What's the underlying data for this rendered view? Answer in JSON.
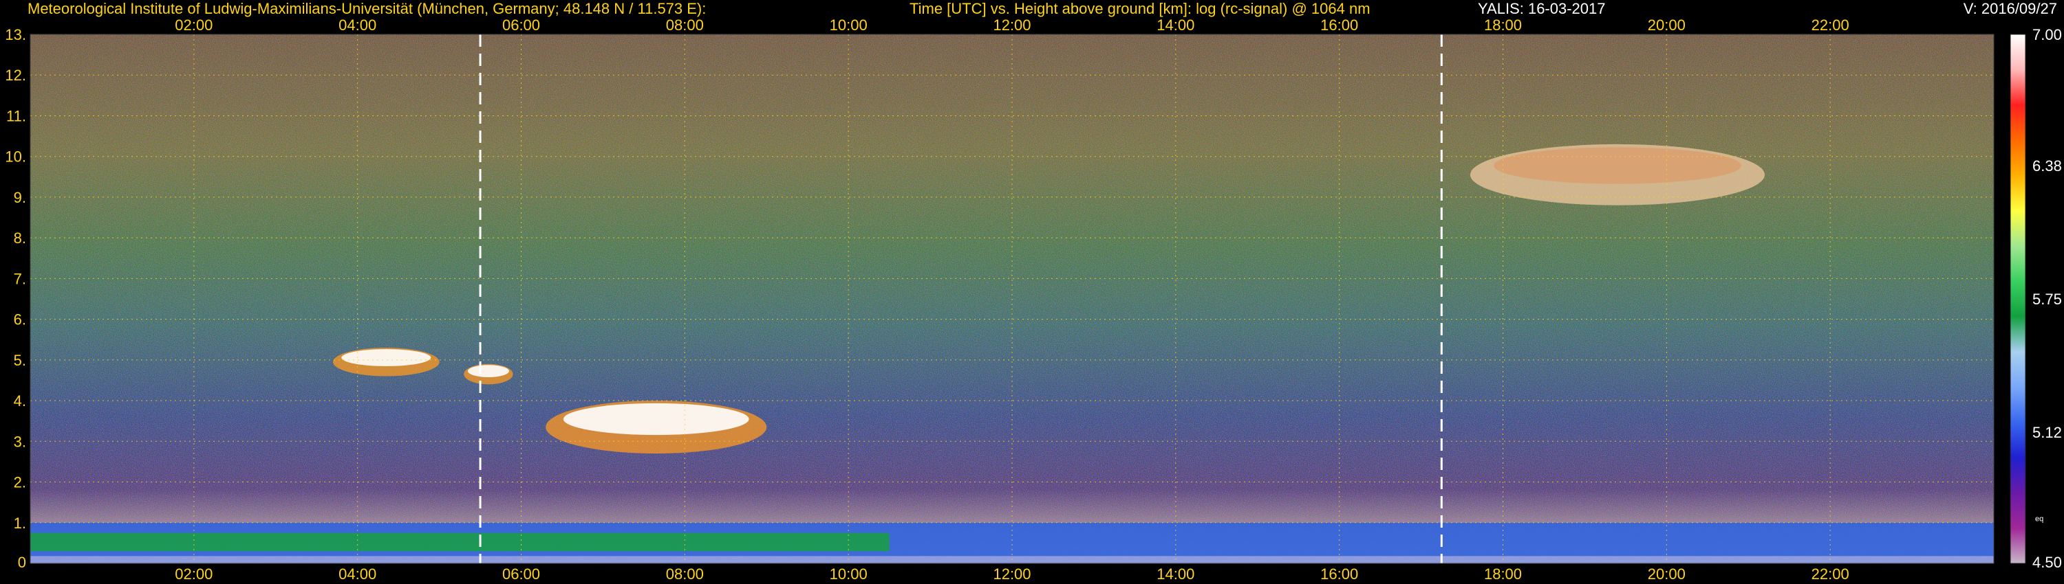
{
  "header": {
    "institute": "Meteorological Institute of Ludwig-Maximilians-Universität (München, Germany; 48.148 N / 11.573 E):",
    "axes_title": "Time [UTC] vs. Height above ground [km]: log (rc-signal) @ 1064 nm",
    "instrument": "YALIS: 16-03-2017",
    "version": "V: 2016/09/27"
  },
  "colors": {
    "text": "#ffd21a",
    "grid": "#ffd21a",
    "background": "#000000",
    "marker": "#ffffff"
  },
  "chart_data": {
    "type": "heatmap",
    "title": "Time [UTC] vs. Height above ground [km]: log (rc-signal) @ 1064 nm",
    "xlabel": "Time [UTC]",
    "ylabel": "Height above ground [km]",
    "xlim": [
      0,
      24
    ],
    "ylim": [
      0,
      13
    ],
    "x_ticks": [
      "02:00",
      "04:00",
      "06:00",
      "08:00",
      "10:00",
      "12:00",
      "14:00",
      "16:00",
      "18:00",
      "20:00",
      "22:00"
    ],
    "y_ticks": [
      "0",
      "1.",
      "2.",
      "3.",
      "4.",
      "5.",
      "6.",
      "7.",
      "8.",
      "9.",
      "10.",
      "11.",
      "12.",
      "13."
    ],
    "grid": true,
    "markers_utc": [
      5.5,
      17.25
    ],
    "colorbar": {
      "min": 4.5,
      "max": 7.0,
      "labels": [
        "7.00",
        "6.38",
        "5.75",
        "5.12",
        "4.50"
      ],
      "small_label": "eq",
      "colors": [
        "#c8b8c8",
        "#a02898",
        "#6a1aa8",
        "#2020d0",
        "#3868f0",
        "#7aa8f8",
        "#a8d0f0",
        "#12a040",
        "#3ad060",
        "#a0e890",
        "#ffff40",
        "#ffb000",
        "#ff6a00",
        "#ff2020",
        "#ffb8b8",
        "#ffffff"
      ]
    },
    "features": [
      {
        "name": "boundary layer",
        "t_start": 0.0,
        "t_end": 24.0,
        "h_bottom": 0.0,
        "h_top": 1.0
      },
      {
        "name": "cloud",
        "t_start": 3.7,
        "t_end": 5.0,
        "h_bottom": 4.6,
        "h_top": 5.3
      },
      {
        "name": "cloud",
        "t_start": 5.3,
        "t_end": 5.9,
        "h_bottom": 4.4,
        "h_top": 4.9
      },
      {
        "name": "cloud",
        "t_start": 6.3,
        "t_end": 9.0,
        "h_bottom": 2.7,
        "h_top": 4.0
      },
      {
        "name": "cirrus",
        "t_start": 17.6,
        "t_end": 21.2,
        "h_bottom": 8.8,
        "h_top": 10.3
      }
    ]
  }
}
